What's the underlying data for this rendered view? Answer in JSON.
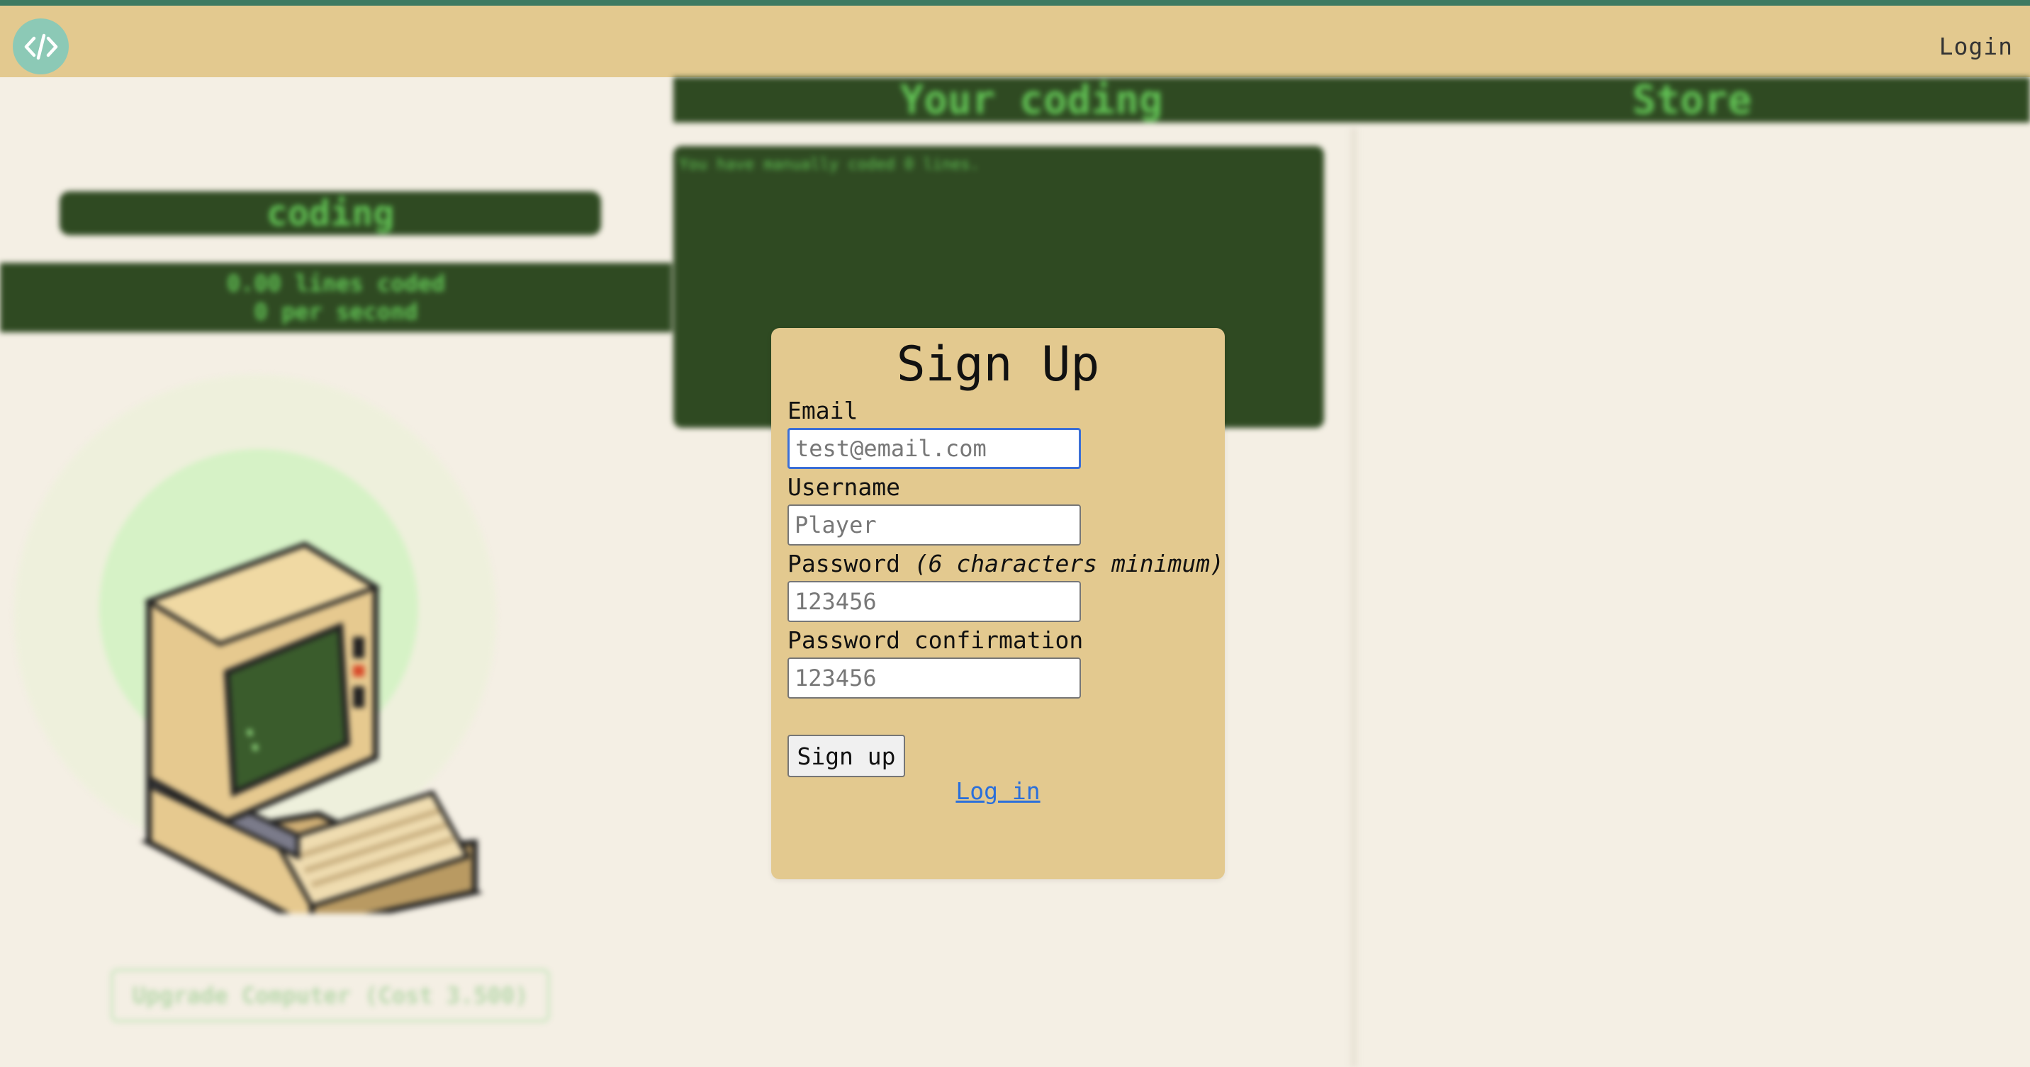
{
  "nav": {
    "login_label": "Login",
    "logo_icon": "code-brackets-icon"
  },
  "background": {
    "coding_header": "Your coding",
    "store_header": "Store",
    "coding_pill": "coding",
    "lines_coded": "0.00 lines coded",
    "per_second": "0 per second",
    "manual_text": "You have manually coded 0 lines.",
    "upgrade_button": "Upgrade Computer (Cost 3.500)"
  },
  "signup": {
    "title": "Sign Up",
    "email_label": "Email",
    "email_placeholder": "test@email.com",
    "username_label": "Username",
    "username_placeholder": "Player",
    "password_label": "Password",
    "password_hint": "(6 characters minimum)",
    "password_placeholder": "123456",
    "confirm_label": "Password confirmation",
    "confirm_placeholder": "123456",
    "submit_label": "Sign up",
    "login_link": "Log in"
  },
  "colors": {
    "accent_green": "#2f4a22",
    "text_green": "#62c455",
    "tan": "#e3c98f",
    "logo_teal": "#8cc9b6",
    "link_blue": "#2a6fdb"
  }
}
